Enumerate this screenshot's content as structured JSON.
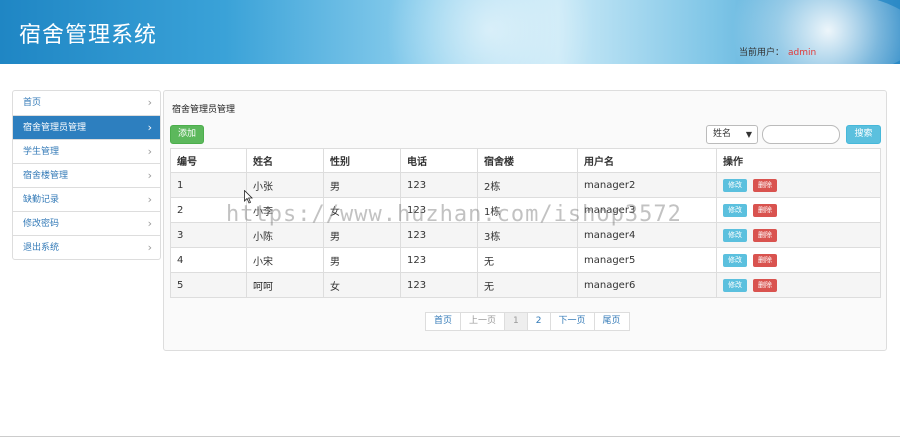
{
  "header": {
    "title": "宿舍管理系统",
    "current_user_label": "当前用户：",
    "current_user": "admin"
  },
  "sidebar": {
    "items": [
      {
        "label": "首页",
        "active": false
      },
      {
        "label": "宿舍管理员管理",
        "active": true
      },
      {
        "label": "学生管理",
        "active": false
      },
      {
        "label": "宿舍楼管理",
        "active": false
      },
      {
        "label": "缺勤记录",
        "active": false
      },
      {
        "label": "修改密码",
        "active": false
      },
      {
        "label": "退出系统",
        "active": false
      }
    ]
  },
  "panel": {
    "title": "宿舍管理员管理",
    "add_label": "添加",
    "filter_selected": "姓名",
    "search_value": "",
    "search_label": "搜索"
  },
  "table": {
    "columns": [
      "编号",
      "姓名",
      "性别",
      "电话",
      "宿舍楼",
      "用户名",
      "操作"
    ],
    "rows": [
      [
        "1",
        "小张",
        "男",
        "123",
        "2栋",
        "manager2"
      ],
      [
        "2",
        "小李",
        "女",
        "123",
        "1栋",
        "manager3"
      ],
      [
        "3",
        "小陈",
        "男",
        "123",
        "3栋",
        "manager4"
      ],
      [
        "4",
        "小宋",
        "男",
        "123",
        "无",
        "manager5"
      ],
      [
        "5",
        "呵呵",
        "女",
        "123",
        "无",
        "manager6"
      ]
    ],
    "edit_label": "修改",
    "delete_label": "删除"
  },
  "pager": {
    "first": "首页",
    "prev": "上一页",
    "pages": [
      "1",
      "2"
    ],
    "current": "1",
    "next": "下一页",
    "last": "尾页"
  },
  "watermark": "https://www.huzhan.com/ishop3572",
  "colors": {
    "header_blue": "#1f86c4",
    "active_nav": "#2d7fbf",
    "add_green": "#5cb85c",
    "info_blue": "#5bc0de",
    "danger_red": "#d9534f",
    "user_red": "#e03a3a"
  }
}
